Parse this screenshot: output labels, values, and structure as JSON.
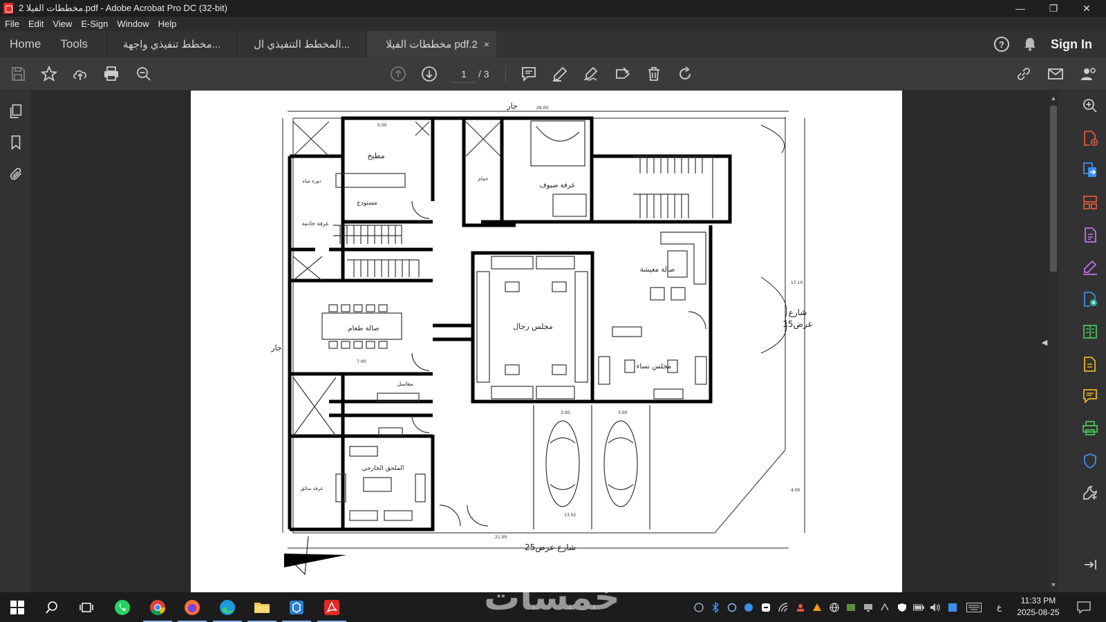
{
  "window": {
    "title": "مخططات الفيلا 2.pdf - Adobe Acrobat Pro DC (32-bit)",
    "minimize": "—",
    "restore": "❐",
    "close": "✕"
  },
  "menu": [
    "File",
    "Edit",
    "View",
    "E-Sign",
    "Window",
    "Help"
  ],
  "tabs": {
    "home": "Home",
    "tools": "Tools",
    "documents": [
      {
        "label": "مخطط تنفيذي واجهة...",
        "active": false
      },
      {
        "label": "المخطط التنفيذي ال...",
        "active": false
      },
      {
        "label": "مخططات الفيلا pdf.2",
        "active": true
      }
    ],
    "close_glyph": "×",
    "help_glyph": "?",
    "sign_in": "Sign In"
  },
  "toolbar": {
    "current_page": "1",
    "total_pages": "/ 3"
  },
  "plan": {
    "labels": {
      "kitchen": "مطبخ",
      "store": "مستودع",
      "maid_room": "غرفة خادمة",
      "guest_room": "غرفة ضيوف",
      "bathroom": "حمام",
      "living": "صالة معيشة",
      "mens_majlis": "مجلس رجال",
      "womens_majlis": "مجلس نساء",
      "dining": "صالة طعام",
      "wc": "دورة مياه",
      "sinks": "مغاسل",
      "annex": "الملحق الخارجي",
      "driver_room": "غرفة سائق",
      "neighbor_top": "جار",
      "neighbor_left": "جار",
      "street_east": "شارع",
      "street_east_width": "عرض15",
      "street_south": "شارع عرض25"
    },
    "dims": {
      "top": "26.00",
      "bottom": "21.00",
      "parking_bottom": "13.52",
      "parking_a": "3.00",
      "parking_b": "3.00",
      "kitchen_w": "5.00",
      "dining_w": "7.00",
      "east_h": "17.10",
      "corner": "4.00"
    }
  },
  "taskbar": {
    "time": "11:33 PM",
    "date": "2025-08-25",
    "lang": "ع",
    "watermark": "خمسات"
  },
  "colors": {
    "titlebar": "#1f1f1f",
    "menubar": "#2c2c2c",
    "tabbar": "#323232",
    "toolbar": "#3b3b3b",
    "document_bg": "#2a2a2a",
    "taskbar": "#1c1c1c",
    "acrobat_red": "#e22a26",
    "tool_accent": "#c06ef0"
  }
}
